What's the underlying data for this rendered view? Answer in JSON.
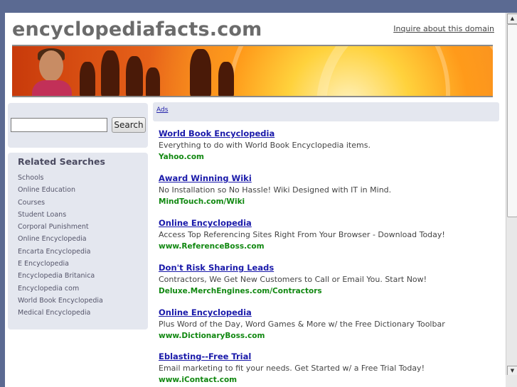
{
  "site": {
    "title": "encyclopediafacts.com",
    "inquire_link": "Inquire about this domain"
  },
  "search": {
    "button_label": "Search",
    "value": "",
    "placeholder": ""
  },
  "related": {
    "heading": "Related Searches",
    "items": [
      "Schools",
      "Online Education",
      "Courses",
      "Student Loans",
      "Corporal Punishment",
      "Online Encyclopedia",
      "Encarta Encyclopedia",
      "E Encyclopedia",
      "Encyclopedia Britanica",
      "Encyclopedia com",
      "World Book Encyclopedia",
      "Medical Encyclopedia"
    ]
  },
  "ads_label": "Ads",
  "ads": [
    {
      "title": "World Book Encyclopedia",
      "desc": "Everything to do with World Book Encyclopedia items.",
      "url": "Yahoo.com"
    },
    {
      "title": "Award Winning Wiki",
      "desc": "No Installation so No Hassle! Wiki Designed with IT in Mind.",
      "url": "MindTouch.com/Wiki"
    },
    {
      "title": "Online Encyclopedia",
      "desc": "Access Top Referencing Sites Right From Your Browser - Download Today!",
      "url": "www.ReferenceBoss.com"
    },
    {
      "title": "Don't Risk Sharing Leads",
      "desc": "Contractors, We Get New Customers to Call or Email You. Start Now!",
      "url": "Deluxe.MerchEngines.com/Contractors"
    },
    {
      "title": "Online Encyclopedia",
      "desc": "Plus Word of the Day, Word Games & More w/ the Free Dictionary Toolbar",
      "url": "www.DictionaryBoss.com"
    },
    {
      "title": "Eblasting--Free Trial",
      "desc": "Email marketing to fit your needs. Get Started w/ a Free Trial Today!",
      "url": "www.iContact.com"
    }
  ],
  "colors": {
    "page_bg": "#5b6a92",
    "ad_title": "#1a1aaa",
    "ad_url": "#118811",
    "panel_bg": "#e4e7ef"
  }
}
